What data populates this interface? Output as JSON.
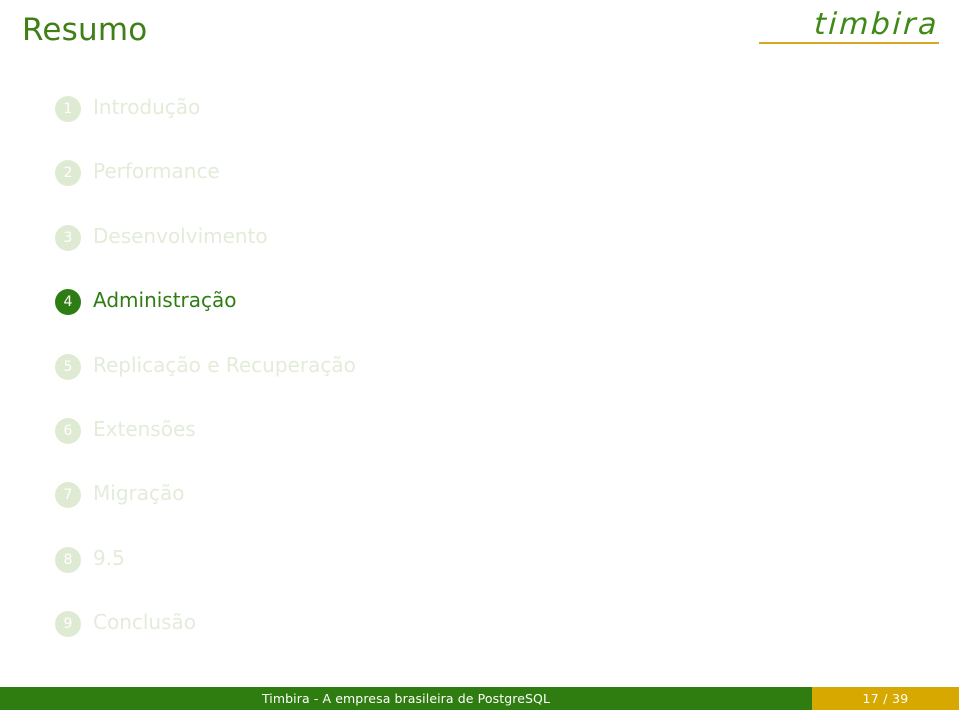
{
  "slide": {
    "title": "Resumo",
    "logo": {
      "text": "timbira",
      "color": "#3f8a17",
      "underline_color": "#d6a824"
    },
    "colors": {
      "title": "#3f7f16",
      "active_green": "#2e7d14",
      "inactive_badge": "#dfead3",
      "inactive_label": "#e3ecd9",
      "footer_green": "#2f7d10",
      "footer_gold": "#d6a800"
    }
  },
  "toc": {
    "items": [
      {
        "number": "1",
        "label": "Introdução",
        "active": false
      },
      {
        "number": "2",
        "label": "Performance",
        "active": false
      },
      {
        "number": "3",
        "label": "Desenvolvimento",
        "active": false
      },
      {
        "number": "4",
        "label": "Administração",
        "active": true
      },
      {
        "number": "5",
        "label": "Replicação e Recuperação",
        "active": false
      },
      {
        "number": "6",
        "label": "Extensões",
        "active": false
      },
      {
        "number": "7",
        "label": "Migração",
        "active": false
      },
      {
        "number": "8",
        "label": "9.5",
        "active": false
      },
      {
        "number": "9",
        "label": "Conclusão",
        "active": false
      }
    ]
  },
  "footer": {
    "text": "Timbira - A empresa brasileira de PostgreSQL",
    "page": "17 / 39"
  }
}
